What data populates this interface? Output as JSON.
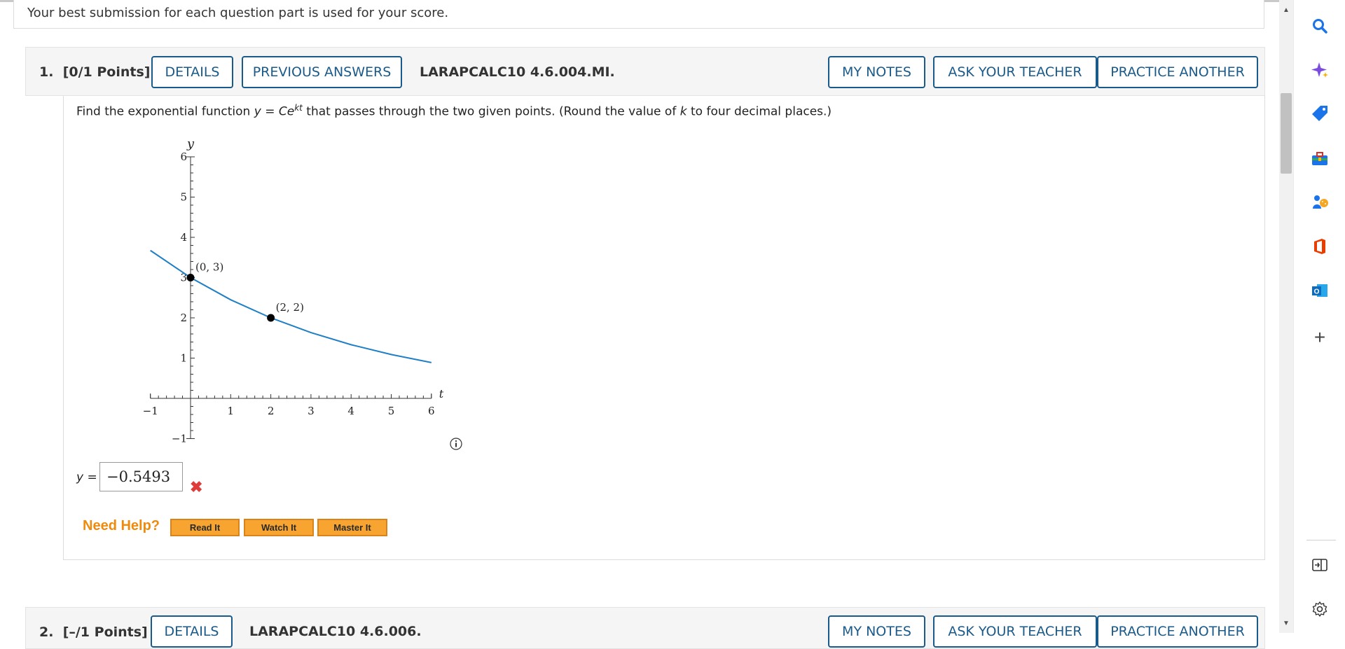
{
  "notice": "Your best submission for each question part is used for your score.",
  "question1": {
    "number": "1.",
    "points": "[0/1 Points]",
    "buttons": {
      "details": "DETAILS",
      "previous_answers": "PREVIOUS ANSWERS",
      "my_notes": "MY NOTES",
      "ask_teacher": "ASK YOUR TEACHER",
      "practice_another": "PRACTICE ANOTHER"
    },
    "code": "LARAPCALC10 4.6.004.MI.",
    "prompt": {
      "before": "Find the exponential function",
      "var_y": "y",
      "equals": "=",
      "func": "Ce",
      "exp": "kt",
      "middle": "that passes through the two given points. (Round the value of",
      "var_k": "k",
      "after": "to four decimal places.)"
    },
    "answer_label_var": "y",
    "answer_label_eq": "=",
    "answer_value": "−0.5493",
    "answer_status": "incorrect",
    "help": {
      "label": "Need Help?",
      "read_it": "Read It",
      "watch_it": "Watch It",
      "master_it": "Master It"
    }
  },
  "chart_data": {
    "type": "line",
    "xlabel": "t",
    "ylabel": "y",
    "xlim": [
      -1,
      6
    ],
    "ylim": [
      -1,
      6
    ],
    "x_ticks": [
      "−1",
      "1",
      "2",
      "3",
      "4",
      "5",
      "6"
    ],
    "y_ticks": [
      "−1",
      "1",
      "2",
      "3",
      "4",
      "5",
      "6"
    ],
    "series": [
      {
        "x": [
          -1,
          0,
          1,
          2,
          3,
          4,
          5,
          6
        ],
        "y": [
          3.674,
          3,
          2.449,
          2,
          1.633,
          1.333,
          1.089,
          0.889
        ]
      }
    ],
    "points": [
      {
        "x": 0,
        "y": 3,
        "label": "(0, 3)"
      },
      {
        "x": 2,
        "y": 2,
        "label": "(2, 2)"
      }
    ],
    "grid": false,
    "curve_color": "#1f7fc6"
  },
  "question2": {
    "number": "2.",
    "points": "[–/1 Points]",
    "buttons": {
      "details": "DETAILS",
      "my_notes": "MY NOTES",
      "ask_teacher": "ASK YOUR TEACHER",
      "practice_another": "PRACTICE ANOTHER"
    },
    "code": "LARAPCALC10 4.6.006."
  },
  "sidebar_icons": [
    "search-icon",
    "copilot-icon",
    "shopping-icon",
    "tools-icon",
    "games-icon",
    "office-icon",
    "outlook-icon",
    "add-icon",
    "split-screen-icon",
    "settings-icon"
  ],
  "scrollbar": {
    "up": "▲",
    "down": "▼"
  },
  "side_add_glyph": "+"
}
